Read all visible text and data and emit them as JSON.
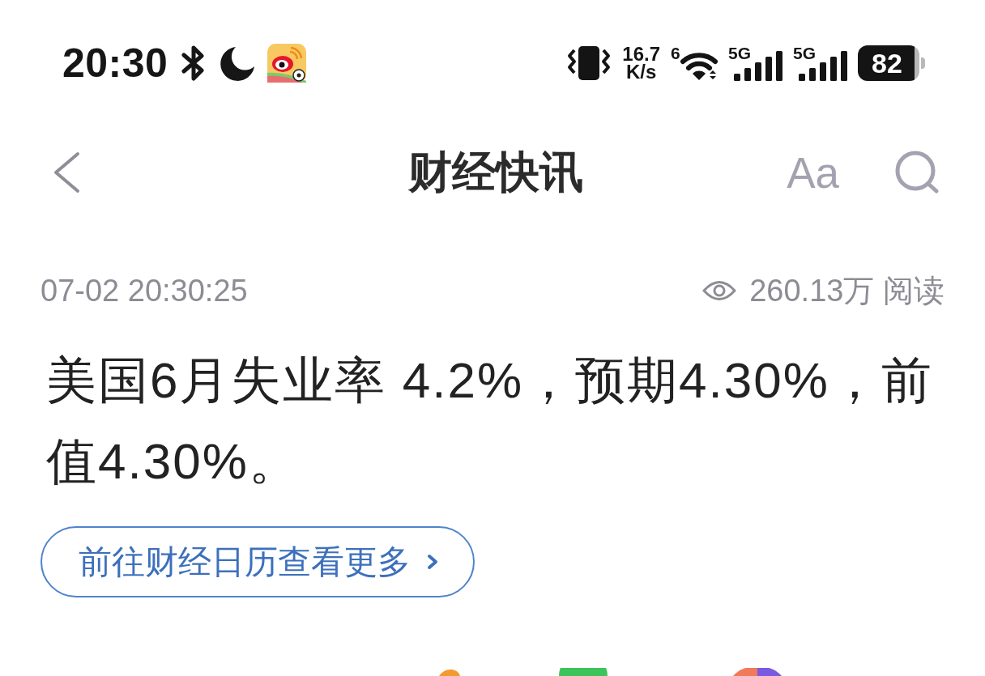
{
  "status_bar": {
    "time": "20:30",
    "network_speed": [
      "16.7",
      "K/s"
    ],
    "wifi_label": "6",
    "signals": [
      {
        "network": "5G"
      },
      {
        "network": "5G"
      }
    ],
    "battery": "82"
  },
  "nav_bar": {
    "title": "财经快讯",
    "font_size_button": "Aa"
  },
  "article": {
    "timestamp": "07-02 20:30:25",
    "views": "260.13万 阅读",
    "body": "美国6月失业率 4.2%，预期4.30%，前值4.30%。",
    "calendar_link": "前往财经日历查看更多"
  }
}
